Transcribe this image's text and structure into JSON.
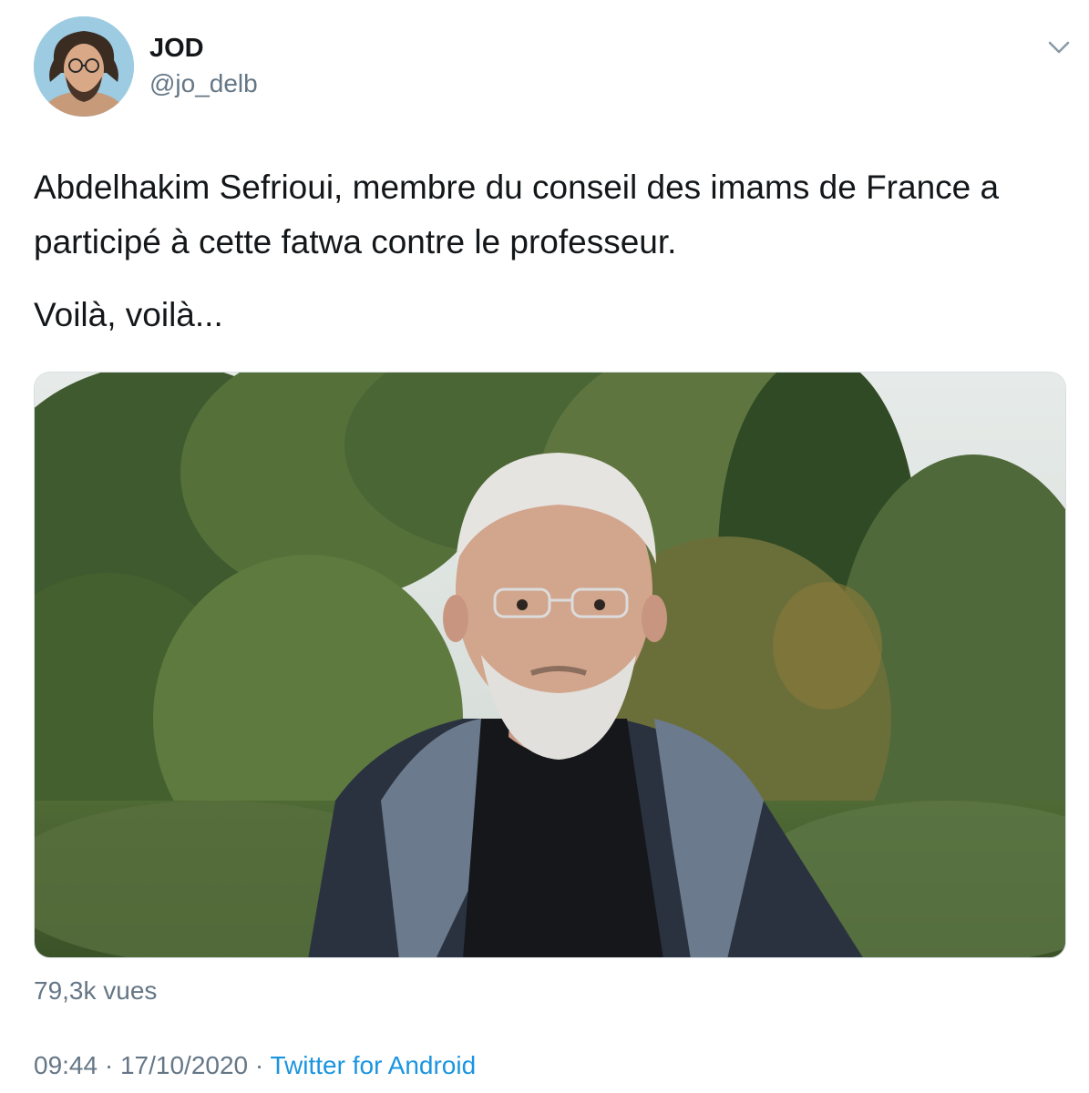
{
  "author": {
    "display_name": "JOD",
    "handle": "@jo_delb",
    "avatar_icon": "avatar-photo"
  },
  "tweet": {
    "paragraphs": [
      "Abdelhakim Sefrioui, membre du conseil des imams de France a participé à cette fatwa contre le professeur.",
      "Voilà, voilà..."
    ],
    "media_icon": "video-thumbnail",
    "views": "79,3k vues",
    "time": "09:44",
    "separator": " · ",
    "date": "17/10/2020",
    "source": "Twitter for Android"
  },
  "icons": {
    "more": "chevron-down-icon"
  },
  "colors": {
    "text": "#14171a",
    "secondary": "#657786",
    "link": "#1b95e0"
  }
}
